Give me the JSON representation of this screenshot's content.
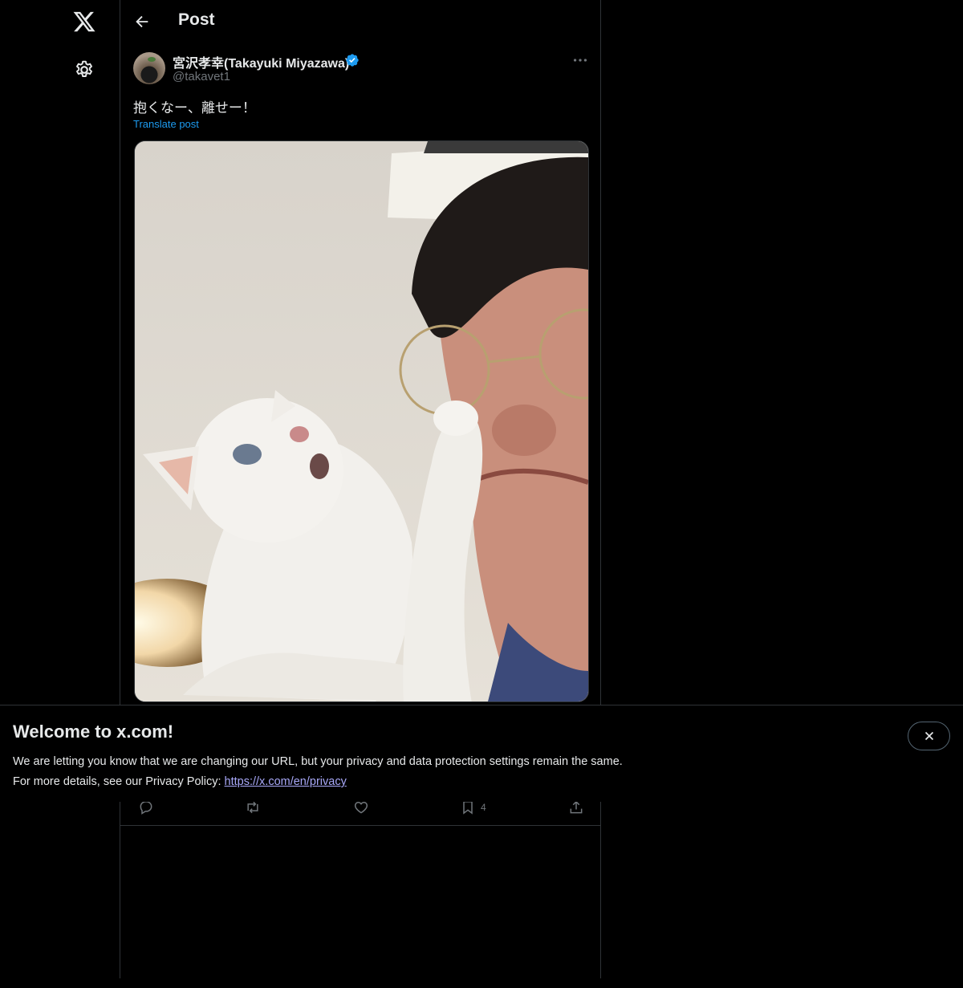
{
  "nav": {
    "logo_icon": "x-logo-icon",
    "settings_icon": "gear-icon"
  },
  "header": {
    "title": "Post",
    "back_icon": "arrow-left-icon"
  },
  "post": {
    "display_name": "宮沢孝幸(Takayuki Miyazawa)",
    "handle": "@takavet1",
    "text": "抱くなー、離せー！",
    "translate_label": "Translate post",
    "more_icon": "ellipsis-icon",
    "verified_icon": "verified-badge-icon",
    "verified_color": "#1d9bf0"
  },
  "actions": {
    "reply_icon": "reply-icon",
    "repost_icon": "repost-icon",
    "like_icon": "heart-icon",
    "bookmark_icon": "bookmark-icon",
    "bookmark_count": "4",
    "share_icon": "share-icon"
  },
  "banner": {
    "title": "Welcome to x.com!",
    "line1": "We are letting you know that we are changing our URL, but your privacy and data protection settings remain the same.",
    "line2_prefix": "For more details, see our Privacy Policy: ",
    "link_text": "https://x.com/en/privacy",
    "close_icon": "close-icon"
  },
  "colors": {
    "background": "#000000",
    "text": "#e7e9ea",
    "muted": "#71767b",
    "accent": "#1d9bf0",
    "link": "#a8a8f8"
  }
}
